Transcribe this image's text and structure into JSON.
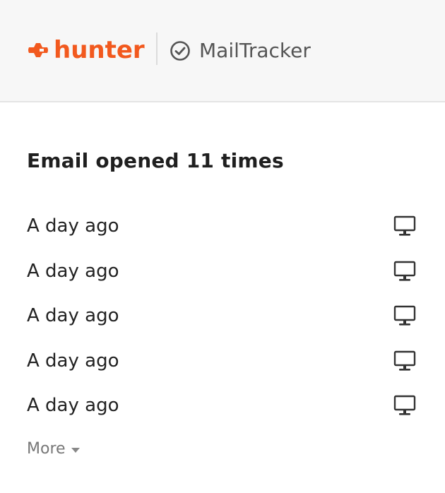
{
  "header": {
    "brand": {
      "name": "hunter",
      "color": "#f2591e",
      "icon": "hunter-logo-icon"
    },
    "product": {
      "name": "MailTracker",
      "icon": "check-circle-icon"
    }
  },
  "summary": {
    "title": "Email opened 11 times"
  },
  "opens": [
    {
      "time": "A day ago",
      "device_icon": "desktop-icon"
    },
    {
      "time": "A day ago",
      "device_icon": "desktop-icon"
    },
    {
      "time": "A day ago",
      "device_icon": "desktop-icon"
    },
    {
      "time": "A day ago",
      "device_icon": "desktop-icon"
    },
    {
      "time": "A day ago",
      "device_icon": "desktop-icon"
    }
  ],
  "more": {
    "label": "More",
    "icon": "caret-down-icon"
  }
}
